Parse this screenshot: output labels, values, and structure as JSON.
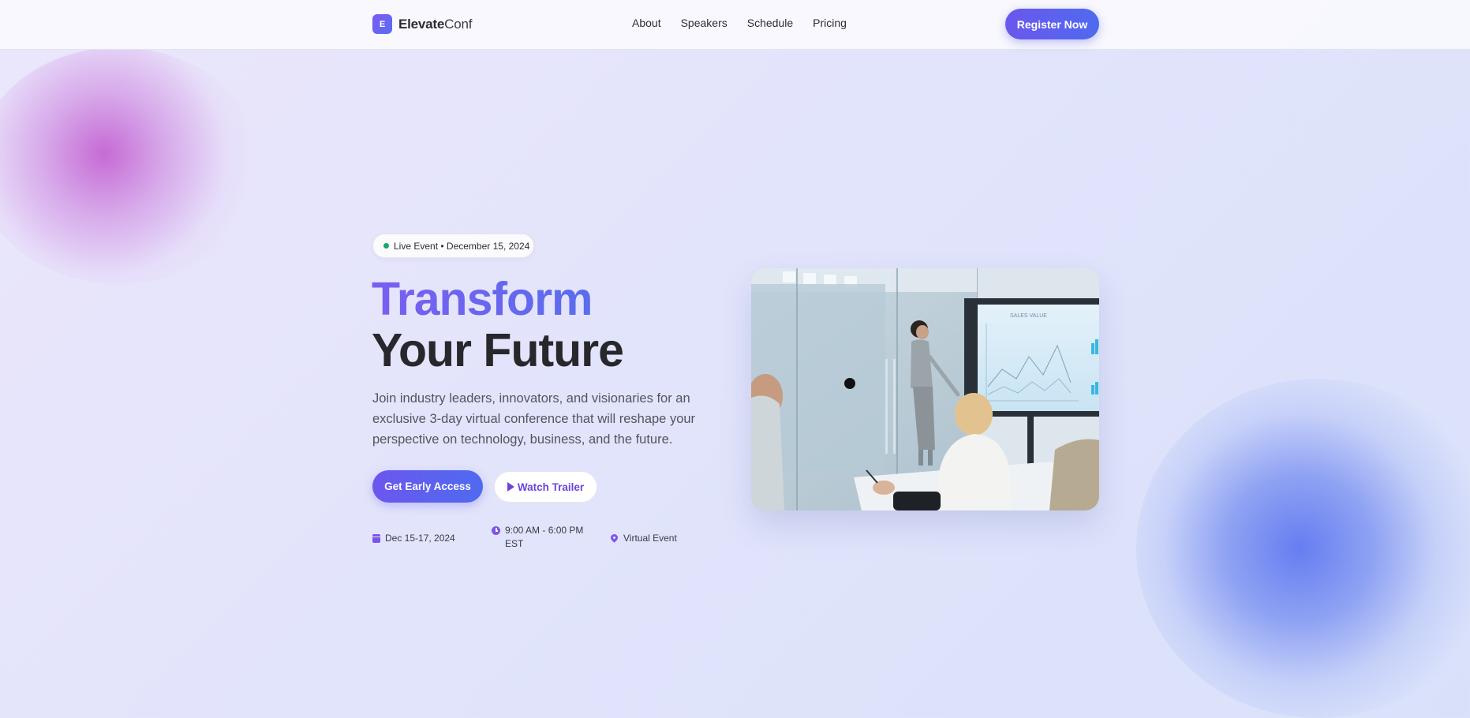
{
  "brand": {
    "mark": "E",
    "name_bold": "Elevate",
    "name_light": "Conf"
  },
  "nav": {
    "items": [
      "About",
      "Speakers",
      "Schedule",
      "Pricing"
    ]
  },
  "header": {
    "register_label": "Register Now"
  },
  "hero": {
    "badge": "Live Event • December 15, 2024",
    "title_line1": "Transform",
    "title_line2": "Your Future",
    "lead": "Join industry leaders, innovators, and visionaries for an exclusive 3-day virtual conference that will reshape your perspective on technology, business, and the future.",
    "cta_primary": "Get Early Access",
    "cta_secondary": "Watch Trailer",
    "meta": {
      "date": "Dec 15-17, 2024",
      "time": "9:00 AM - 6:00 PM EST",
      "location": "Virtual Event"
    },
    "screen_label": "SALES VALUE"
  },
  "colors": {
    "accent_start": "#6b57ee",
    "accent_end": "#4f6aef",
    "live_dot": "#18a86b",
    "icon": "#7b55ea"
  },
  "icons": [
    "calendar-icon",
    "clock-icon",
    "location-pin-icon",
    "play-icon"
  ]
}
